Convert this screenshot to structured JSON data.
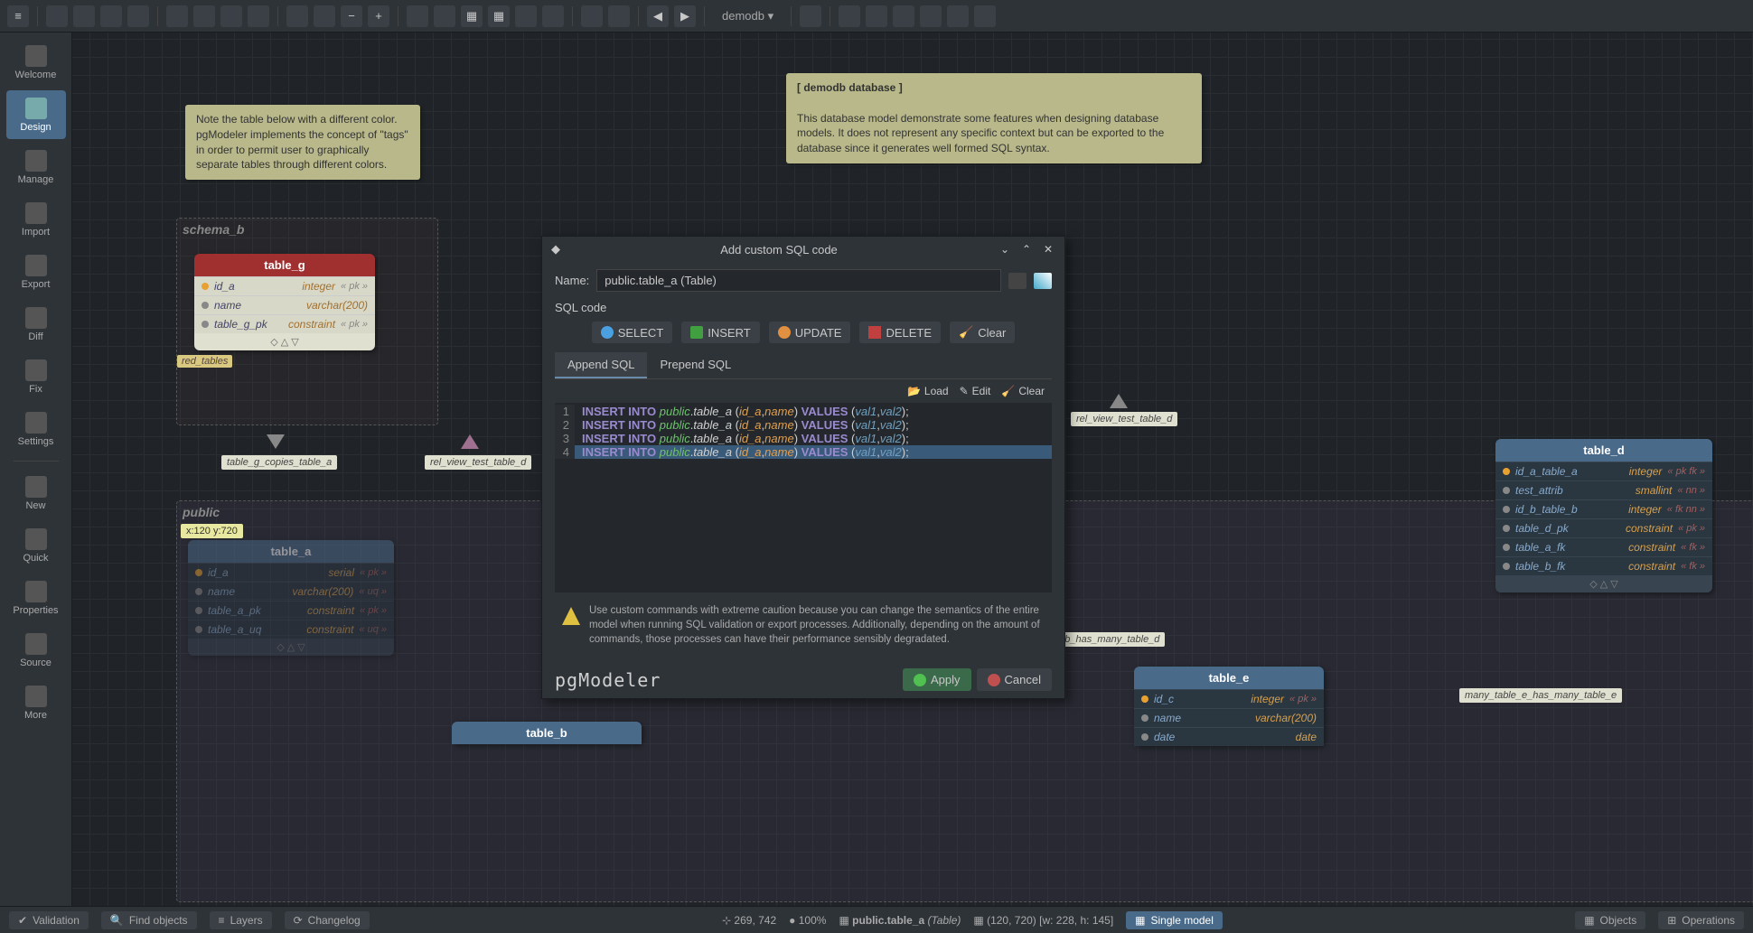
{
  "toolbar": {
    "db": "demodb"
  },
  "sidebar": {
    "items": [
      {
        "label": "Welcome"
      },
      {
        "label": "Design"
      },
      {
        "label": "Manage"
      },
      {
        "label": "Import"
      },
      {
        "label": "Export"
      },
      {
        "label": "Diff"
      },
      {
        "label": "Fix"
      },
      {
        "label": "Settings"
      },
      {
        "label": "New"
      },
      {
        "label": "Quick"
      },
      {
        "label": "Properties"
      },
      {
        "label": "Source"
      },
      {
        "label": "More"
      }
    ]
  },
  "notes": {
    "tags": "Note the table below with a different color. pgModeler implements the concept of \"tags\" in order to permit user to graphically separate tables through different colors.",
    "db_title": "[ demodb database ]",
    "db_desc": "This database model demonstrate some features when designing database models. It does not represent any specific context but can be exported to the database since it generates well formed SQL syntax."
  },
  "schema_b": {
    "label": "schema_b"
  },
  "public": {
    "label": "public"
  },
  "table_g": {
    "title": "table_g",
    "rows": [
      {
        "name": "id_a",
        "type": "integer",
        "tag": "« pk »"
      },
      {
        "name": "name",
        "type": "varchar(200)",
        "tag": ""
      },
      {
        "name": "table_g_pk",
        "type": "constraint",
        "tag": "« pk »"
      }
    ]
  },
  "red_tag": "red_tables",
  "table_a": {
    "title": "table_a",
    "rows": [
      {
        "name": "id_a",
        "type": "serial",
        "tag": "« pk »"
      },
      {
        "name": "name",
        "type": "varchar(200)",
        "tag": "« uq »"
      },
      {
        "name": "table_a_pk",
        "type": "constraint",
        "tag": "« pk »"
      },
      {
        "name": "table_a_uq",
        "type": "constraint",
        "tag": "« uq »"
      }
    ]
  },
  "coord_tip": "x:120 y:720",
  "table_d": {
    "title": "table_d",
    "rows": [
      {
        "name": "id_a_table_a",
        "type": "integer",
        "tag": "« pk fk »"
      },
      {
        "name": "test_attrib",
        "type": "smallint",
        "tag": "« nn »"
      },
      {
        "name": "id_b_table_b",
        "type": "integer",
        "tag": "« fk nn »"
      },
      {
        "name": "table_d_pk",
        "type": "constraint",
        "tag": "« pk »"
      },
      {
        "name": "table_a_fk",
        "type": "constraint",
        "tag": "« fk »"
      },
      {
        "name": "table_b_fk",
        "type": "constraint",
        "tag": "« fk »"
      }
    ]
  },
  "table_e": {
    "title": "table_e",
    "rows": [
      {
        "name": "id_c",
        "type": "integer",
        "tag": "« pk »"
      },
      {
        "name": "name",
        "type": "varchar(200)",
        "tag": ""
      },
      {
        "name": "date",
        "type": "date",
        "tag": ""
      }
    ]
  },
  "table_b": {
    "title": "table_b"
  },
  "rel_labels": {
    "g_copies_a": "table_g_copies_table_a",
    "view_test_d": "rel_view_test_table_d",
    "view_test_d2": "rel_view_test_table_d",
    "b_many_d": "e_b_has_many_table_d",
    "e_many_e": "many_table_e_has_many_table_e"
  },
  "dialog": {
    "title": "Add custom SQL code",
    "name_label": "Name:",
    "name_value": "public.table_a (Table)",
    "sqlcode_label": "SQL code",
    "buttons": {
      "select": "SELECT",
      "insert": "INSERT",
      "update": "UPDATE",
      "delete": "DELETE",
      "clear": "Clear"
    },
    "tabs": {
      "append": "Append SQL",
      "prepend": "Prepend SQL"
    },
    "code_tb": {
      "load": "Load",
      "edit": "Edit",
      "clear": "Clear"
    },
    "code": [
      {
        "kw": "INSERT INTO",
        "sch": "public",
        "tbl": "table_a",
        "cols": "id_a,name",
        "kw2": "VALUES",
        "vals": "val1,val2"
      },
      {
        "kw": "INSERT INTO",
        "sch": "public",
        "tbl": "table_a",
        "cols": "id_a,name",
        "kw2": "VALUES",
        "vals": "val1,val2"
      },
      {
        "kw": "INSERT INTO",
        "sch": "public",
        "tbl": "table_a",
        "cols": "id_a,name",
        "kw2": "VALUES",
        "vals": "val1,val2"
      },
      {
        "kw": "INSERT INTO",
        "sch": "public",
        "tbl": "table_a",
        "cols": "id_a,name",
        "kw2": "VALUES",
        "vals": "val1,val2"
      }
    ],
    "warning": "Use custom commands with extreme caution because you can change the semantics of the entire model when running SQL validation or export processes. Additionally, depending on the amount of commands, those processes can have their performance sensibly degradated.",
    "logo": "pgModeler",
    "apply": "Apply",
    "cancel": "Cancel"
  },
  "status": {
    "validation": "Validation",
    "find": "Find objects",
    "layers": "Layers",
    "changelog": "Changelog",
    "coords": "269, 742",
    "zoom": "100%",
    "obj": "public.table_a",
    "obj_type": "(Table)",
    "dims": "(120, 720) [w: 228, h: 145]",
    "mode": "Single model",
    "objects": "Objects",
    "operations": "Operations"
  }
}
